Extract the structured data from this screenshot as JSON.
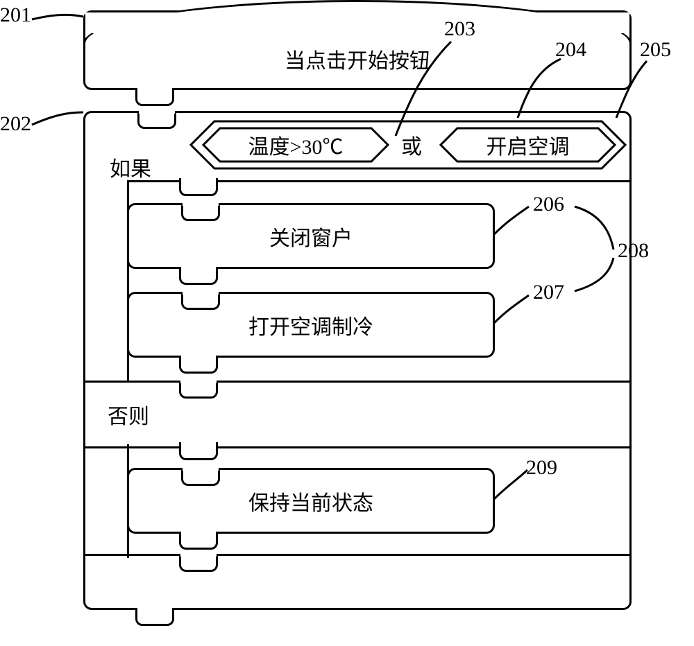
{
  "labels": {
    "201": "201",
    "202": "202",
    "203": "203",
    "204": "204",
    "205": "205",
    "206": "206",
    "207": "207",
    "208": "208",
    "209": "209"
  },
  "blocks": {
    "event_title": "当点击开始按钮",
    "if_label": "如果",
    "else_label": "否则",
    "or_label": "或",
    "condition1": "温度>30℃",
    "condition2": "开启空调",
    "action_close_window": "关闭窗户",
    "action_open_ac": "打开空调制冷",
    "action_keep_state": "保持当前状态"
  }
}
